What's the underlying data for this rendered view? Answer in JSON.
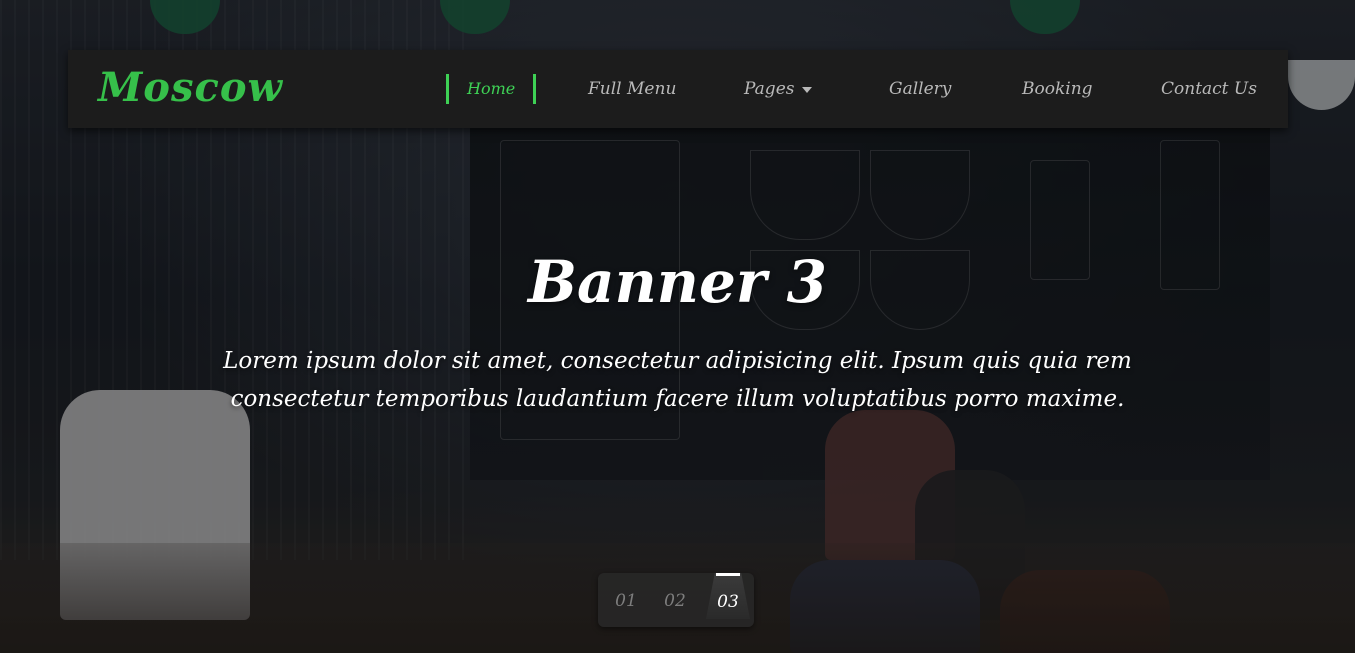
{
  "brand": {
    "name": "Moscow",
    "color": "#36c04a"
  },
  "nav": {
    "items": [
      {
        "label": "Home",
        "active": true
      },
      {
        "label": "Full Menu"
      },
      {
        "label": "Pages",
        "has_dropdown": true,
        "dropdown_icon": "caret-down-icon"
      },
      {
        "label": "Gallery"
      },
      {
        "label": "Booking"
      },
      {
        "label": "Contact Us"
      }
    ],
    "active_color": "#3ed155"
  },
  "hero": {
    "title": "Banner 3",
    "text": "Lorem ipsum dolor sit amet, consectetur adipisicing elit. Ipsum quis quia rem consectetur temporibus laudantium facere illum voluptatibus porro maxime."
  },
  "slider": {
    "pages": [
      "01",
      "02",
      "03"
    ],
    "active_index": 2
  }
}
